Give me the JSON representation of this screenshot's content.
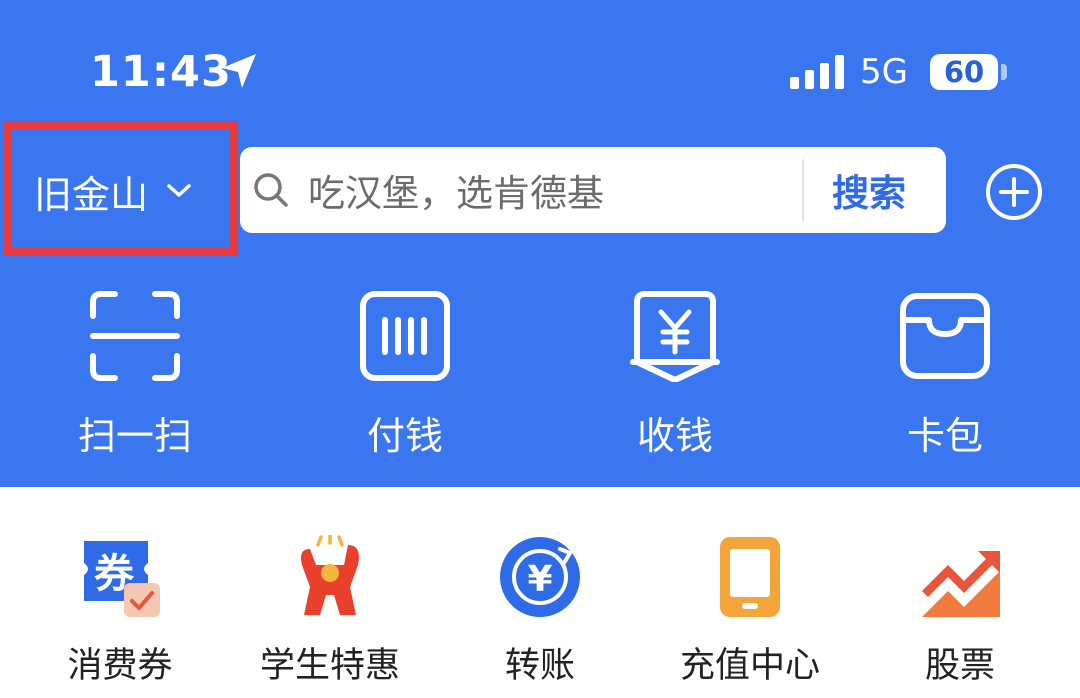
{
  "status_bar": {
    "time": "11:43",
    "network": "5G",
    "battery": "60",
    "icons": [
      "location-arrow-icon",
      "signal-icon",
      "battery-icon"
    ]
  },
  "header": {
    "city": "旧金山",
    "search_placeholder": "吃汉堡，选肯德基",
    "search_button": "搜索",
    "icons": [
      "chevron-down-icon",
      "search-icon",
      "add-circle-icon"
    ]
  },
  "quick_actions": [
    {
      "label": "扫一扫",
      "icon": "scan-icon"
    },
    {
      "label": "付钱",
      "icon": "barcode-icon"
    },
    {
      "label": "收钱",
      "icon": "receive-money-icon"
    },
    {
      "label": "卡包",
      "icon": "wallet-icon"
    }
  ],
  "services": [
    {
      "label": "消费券",
      "icon": "coupon-icon",
      "glyph": "券"
    },
    {
      "label": "学生特惠",
      "icon": "student-deal-icon"
    },
    {
      "label": "转账",
      "icon": "transfer-icon",
      "glyph": "¥"
    },
    {
      "label": "充值中心",
      "icon": "recharge-icon"
    },
    {
      "label": "股票",
      "icon": "stock-icon"
    }
  ],
  "colors": {
    "header_bg": "#3a76f0",
    "highlight_box": "#e63b41",
    "search_button": "#2f6be6"
  }
}
